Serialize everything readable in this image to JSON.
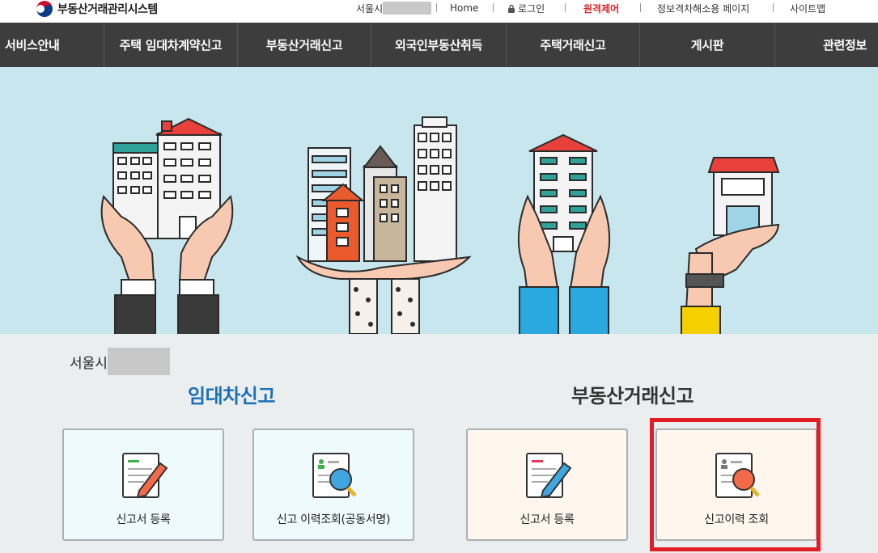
{
  "header": {
    "logo_text": "부동산거래관리시스템",
    "city_prefix": "서울시",
    "links": {
      "home": "Home",
      "login": "로그인",
      "remote_control": "원격제어",
      "info_page": "정보격차해소용 페이지",
      "sitemap": "사이트맵"
    }
  },
  "gnb": {
    "items": [
      "서비스안내",
      "주택 임대차계약신고",
      "부동산거래신고",
      "외국인부동산취득",
      "주택거래신고",
      "게시판",
      "관련정보"
    ]
  },
  "main": {
    "city": "서울시",
    "sections": {
      "rent_title": "임대차신고",
      "trade_title": "부동산거래신고"
    },
    "cards": [
      {
        "label": "신고서 등록",
        "group": "rent"
      },
      {
        "label": "신고 이력조회(공동서명)",
        "group": "rent"
      },
      {
        "label": "신고서 등록",
        "group": "trade"
      },
      {
        "label": "신고이력 조회",
        "group": "trade"
      }
    ]
  },
  "colors": {
    "gnb_bg": "#3d3d3d",
    "banner_bg": "#c7e6ee",
    "rent_accent": "#1a6fb5",
    "highlight": "#e11d25",
    "remote_control": "#d9232a"
  }
}
